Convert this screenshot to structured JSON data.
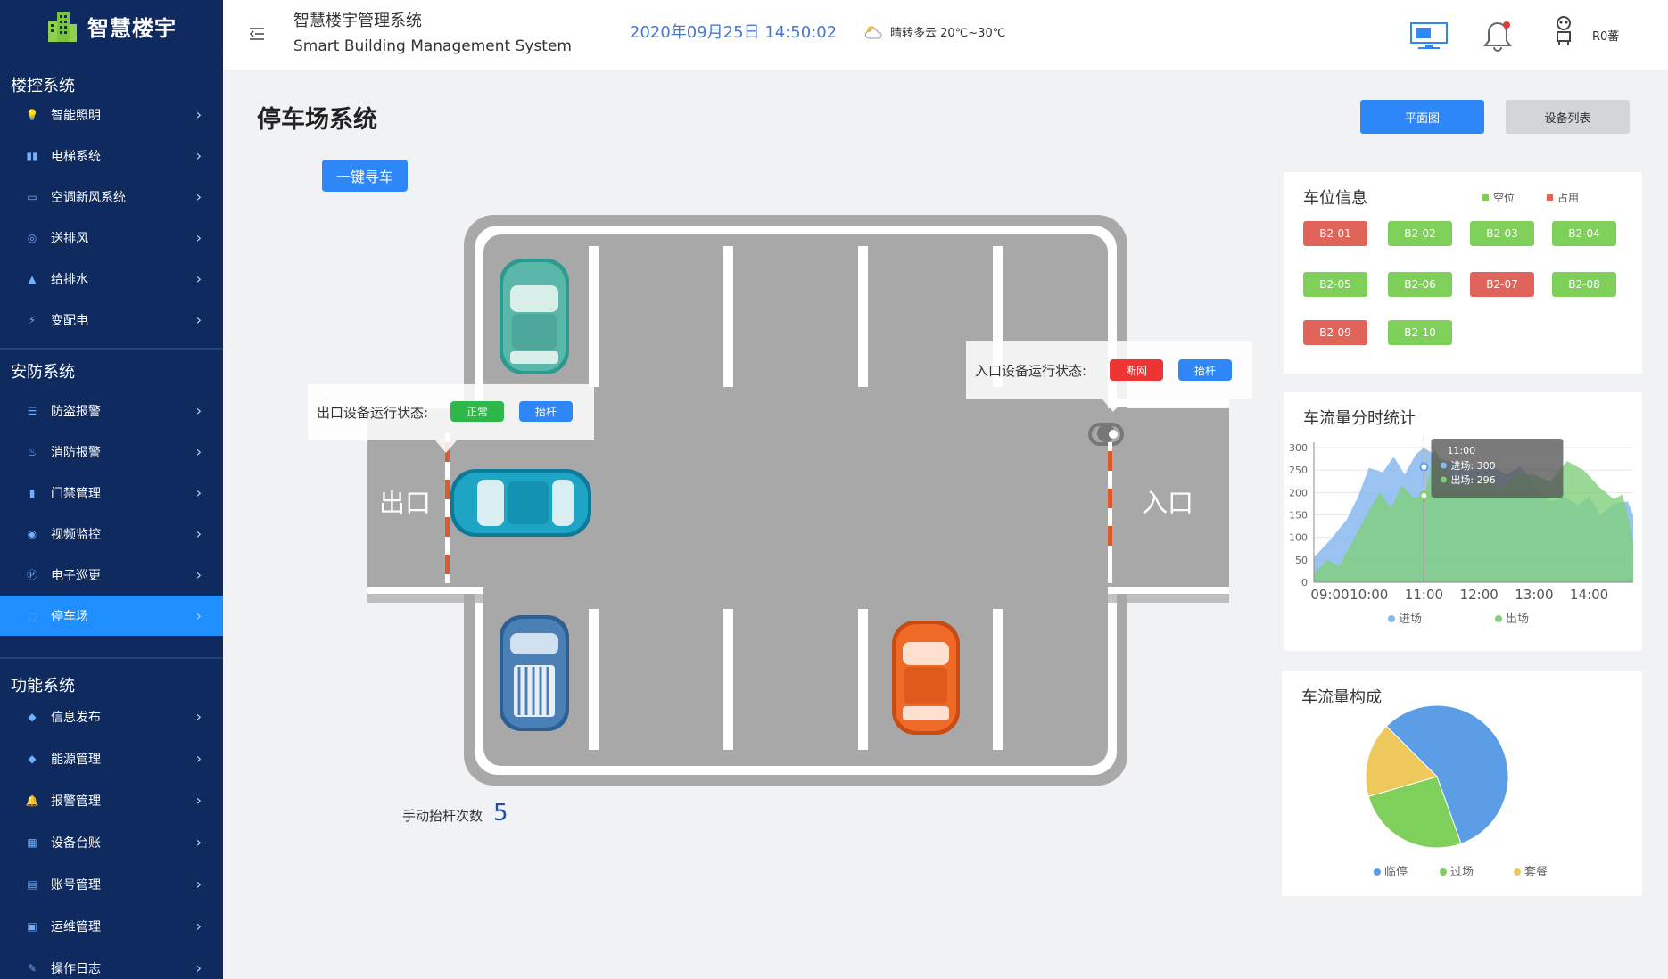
{
  "brand": {
    "logo_text": "智慧楼宇"
  },
  "header": {
    "title_cn": "智慧楼宇管理系统",
    "title_en": "Smart Building Management System",
    "datetime": "2020年09月25日 14:50:02",
    "weather": "晴转多云  20℃~30℃",
    "user": "R0蕃"
  },
  "sidebar": {
    "sections": [
      {
        "title": "楼控系统",
        "items": [
          {
            "label": "智能照明",
            "icon": "bulb-icon"
          },
          {
            "label": "电梯系统",
            "icon": "elevator-icon"
          },
          {
            "label": "空调新风系统",
            "icon": "aircon-icon"
          },
          {
            "label": "送排风",
            "icon": "fan-icon"
          },
          {
            "label": "给排水",
            "icon": "water-icon"
          },
          {
            "label": "变配电",
            "icon": "power-icon"
          }
        ]
      },
      {
        "title": "安防系统",
        "items": [
          {
            "label": "防盗报警",
            "icon": "list-icon"
          },
          {
            "label": "消防报警",
            "icon": "fire-icon"
          },
          {
            "label": "门禁管理",
            "icon": "door-icon"
          },
          {
            "label": "视频监控",
            "icon": "camera-icon"
          },
          {
            "label": "电子巡更",
            "icon": "patrol-icon"
          },
          {
            "label": "停车场",
            "icon": "parking-icon",
            "active": true
          }
        ]
      },
      {
        "title": "功能系统",
        "items": [
          {
            "label": "信息发布",
            "icon": "info-icon"
          },
          {
            "label": "能源管理",
            "icon": "energy-icon"
          },
          {
            "label": "报警管理",
            "icon": "bell-icon"
          },
          {
            "label": "设备台账",
            "icon": "device-icon"
          },
          {
            "label": "账号管理",
            "icon": "account-icon"
          },
          {
            "label": "运维管理",
            "icon": "ops-icon"
          },
          {
            "label": "操作日志",
            "icon": "log-icon"
          }
        ]
      }
    ]
  },
  "main": {
    "page_title": "停车场系统",
    "view_buttons": {
      "plan": "平面图",
      "list": "设备列表"
    },
    "find_car": "一键寻车",
    "exit_label": "出口",
    "entry_label": "入口",
    "exit_status": {
      "label": "出口设备运行状态:",
      "status": "正常",
      "action": "抬杆"
    },
    "entry_status": {
      "label": "入口设备运行状态:",
      "status": "断网",
      "action": "抬杆"
    },
    "manual_count_label": "手动抬杆次数",
    "manual_count": "5"
  },
  "slots": {
    "title": "车位信息",
    "legend_free": "空位",
    "legend_occupied": "占用",
    "colors": {
      "free": "#7ed05b",
      "occupied": "#e0645a"
    },
    "items": [
      {
        "id": "B2-01",
        "occupied": true
      },
      {
        "id": "B2-02",
        "occupied": false
      },
      {
        "id": "B2-03",
        "occupied": false
      },
      {
        "id": "B2-04",
        "occupied": false
      },
      {
        "id": "B2-05",
        "occupied": false
      },
      {
        "id": "B2-06",
        "occupied": false
      },
      {
        "id": "B2-07",
        "occupied": true
      },
      {
        "id": "B2-08",
        "occupied": false
      },
      {
        "id": "B2-09",
        "occupied": true
      },
      {
        "id": "B2-10",
        "occupied": false
      }
    ]
  },
  "chart_data": [
    {
      "type": "area",
      "title": "车流量分时统计",
      "x": [
        "09:00",
        "10:00",
        "11:00",
        "12:00",
        "13:00",
        "14:00"
      ],
      "ylim": [
        0,
        300
      ],
      "yticks": [
        0,
        50,
        100,
        150,
        200,
        250,
        300
      ],
      "legend": "bottom",
      "series": [
        {
          "name": "进场",
          "color": "#8ab8ee",
          "points": [
            [
              0,
              55
            ],
            [
              0.3,
              95
            ],
            [
              0.6,
              140
            ],
            [
              0.8,
              190
            ],
            [
              1.0,
              255
            ],
            [
              1.25,
              245
            ],
            [
              1.45,
              280
            ],
            [
              1.65,
              240
            ],
            [
              1.85,
              285
            ],
            [
              2.0,
              300
            ],
            [
              2.3,
              275
            ],
            [
              2.6,
              265
            ],
            [
              2.9,
              250
            ],
            [
              3.2,
              262
            ],
            [
              3.5,
              240
            ],
            [
              3.75,
              258
            ],
            [
              4.0,
              220
            ],
            [
              4.3,
              180
            ],
            [
              4.55,
              190
            ],
            [
              4.8,
              172
            ],
            [
              5.0,
              190
            ],
            [
              5.2,
              150
            ],
            [
              5.45,
              175
            ],
            [
              5.7,
              180
            ],
            [
              5.8,
              150
            ]
          ]
        },
        {
          "name": "出场",
          "color": "#7fcf7a",
          "points": [
            [
              0,
              20
            ],
            [
              0.25,
              50
            ],
            [
              0.45,
              35
            ],
            [
              0.7,
              90
            ],
            [
              1.0,
              160
            ],
            [
              1.2,
              200
            ],
            [
              1.4,
              165
            ],
            [
              1.6,
              215
            ],
            [
              1.8,
              190
            ],
            [
              2.0,
              190
            ],
            [
              2.2,
              296
            ],
            [
              2.5,
              230
            ],
            [
              2.8,
              215
            ],
            [
              3.1,
              240
            ],
            [
              3.4,
              210
            ],
            [
              3.7,
              245
            ],
            [
              4.0,
              240
            ],
            [
              4.3,
              225
            ],
            [
              4.6,
              270
            ],
            [
              4.9,
              250
            ],
            [
              5.2,
              210
            ],
            [
              5.45,
              185
            ],
            [
              5.6,
              195
            ],
            [
              5.7,
              150
            ],
            [
              5.8,
              90
            ]
          ]
        }
      ],
      "tooltip": {
        "x": "11:00",
        "rows": [
          "进场: 300",
          "出场: 296"
        ]
      }
    },
    {
      "type": "pie",
      "title": "车流量构成",
      "legend": "bottom",
      "slices": [
        {
          "name": "临停",
          "value": 57,
          "color": "#5b9ee6"
        },
        {
          "name": "过场",
          "value": 26,
          "color": "#7ed05b"
        },
        {
          "name": "套餐",
          "value": 17,
          "color": "#ecc95a"
        }
      ]
    }
  ]
}
